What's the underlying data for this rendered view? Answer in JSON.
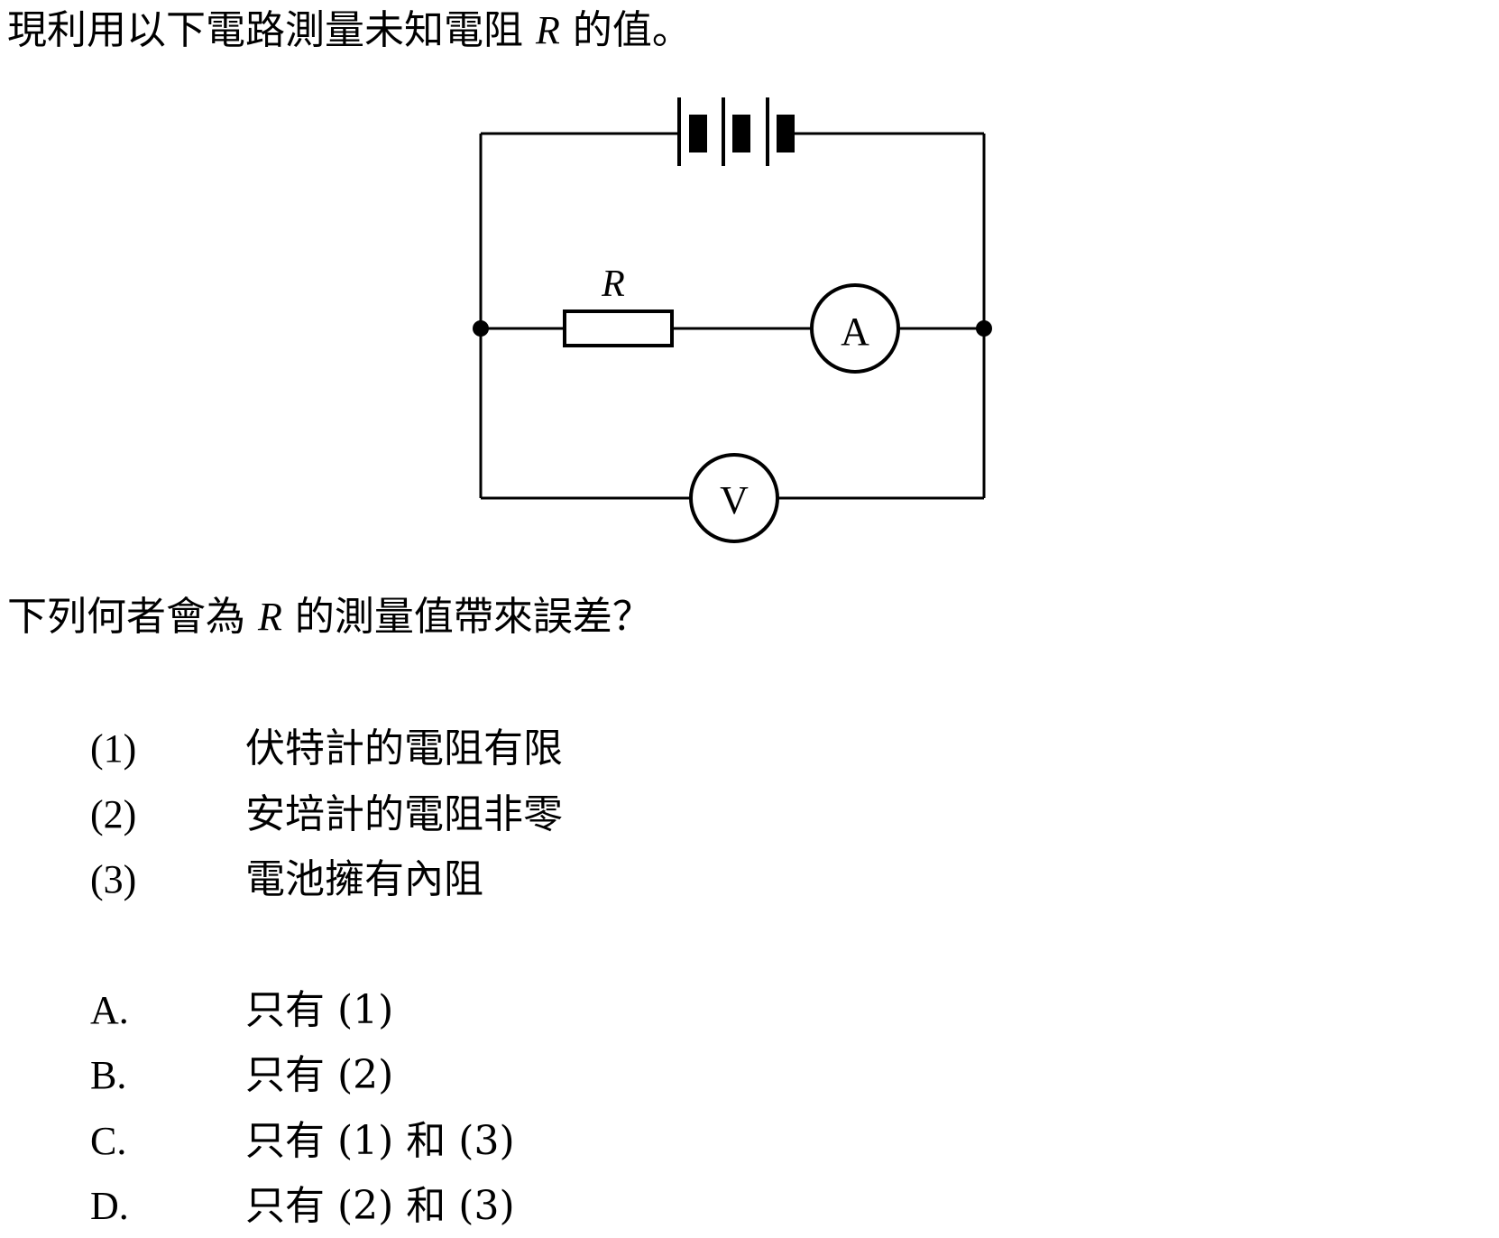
{
  "intro": {
    "before": "現利用以下電路測量未知電阻",
    "variable": "R",
    "after": "的值。"
  },
  "circuit": {
    "resistor_label": "R",
    "ammeter_label": "A",
    "voltmeter_label": "V"
  },
  "question": {
    "before": "下列何者會為",
    "variable": "R",
    "after": "的測量值帶來誤差？"
  },
  "statements": [
    {
      "num": "(1)",
      "text": "伏特計的電阻有限"
    },
    {
      "num": "(2)",
      "text": "安培計的電阻非零"
    },
    {
      "num": "(3)",
      "text": "電池擁有內阻"
    }
  ],
  "options": [
    {
      "letter": "A.",
      "text": "只有 (1)"
    },
    {
      "letter": "B.",
      "text": "只有 (2)"
    },
    {
      "letter": "C.",
      "text": "只有 (1) 和 (3)"
    },
    {
      "letter": "D.",
      "text": "只有 (2) 和 (3)"
    }
  ]
}
